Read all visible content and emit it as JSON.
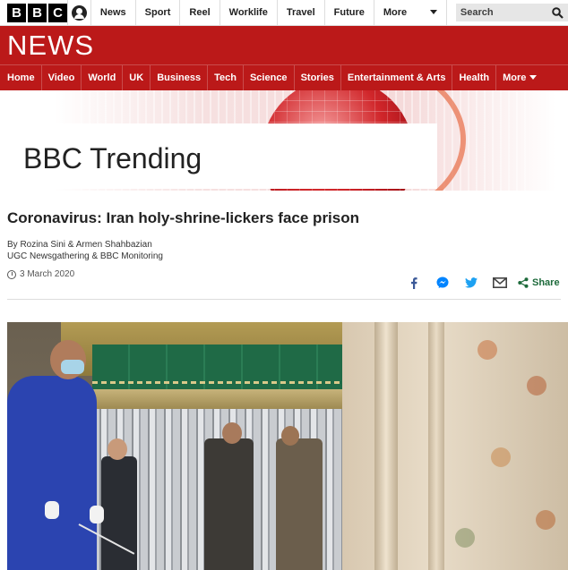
{
  "topbar": {
    "logo_letters": [
      "B",
      "B",
      "C"
    ],
    "account_icon": "account-icon",
    "nav": [
      "News",
      "Sport",
      "Reel",
      "Worklife",
      "Travel",
      "Future"
    ],
    "more_label": "More",
    "search_label": "Search"
  },
  "news_header": {
    "title": "NEWS",
    "nav": [
      "Home",
      "Video",
      "World",
      "UK",
      "Business",
      "Tech",
      "Science",
      "Stories",
      "Entertainment & Arts",
      "Health"
    ],
    "more_label": "More"
  },
  "banner": {
    "title": "BBC Trending"
  },
  "article": {
    "headline": "Coronavirus: Iran holy-shrine-lickers face prison",
    "byline": "By Rozina Sini & Armen Shahbazian",
    "byline_org": "UGC Newsgathering & BBC Monitoring",
    "date": "3 March 2020",
    "share_label": "Share",
    "share_icons": [
      "facebook-icon",
      "messenger-icon",
      "twitter-icon",
      "email-icon",
      "share-icon"
    ]
  },
  "colors": {
    "brand_red": "#bb1919",
    "share_green": "#1d6a3b"
  }
}
